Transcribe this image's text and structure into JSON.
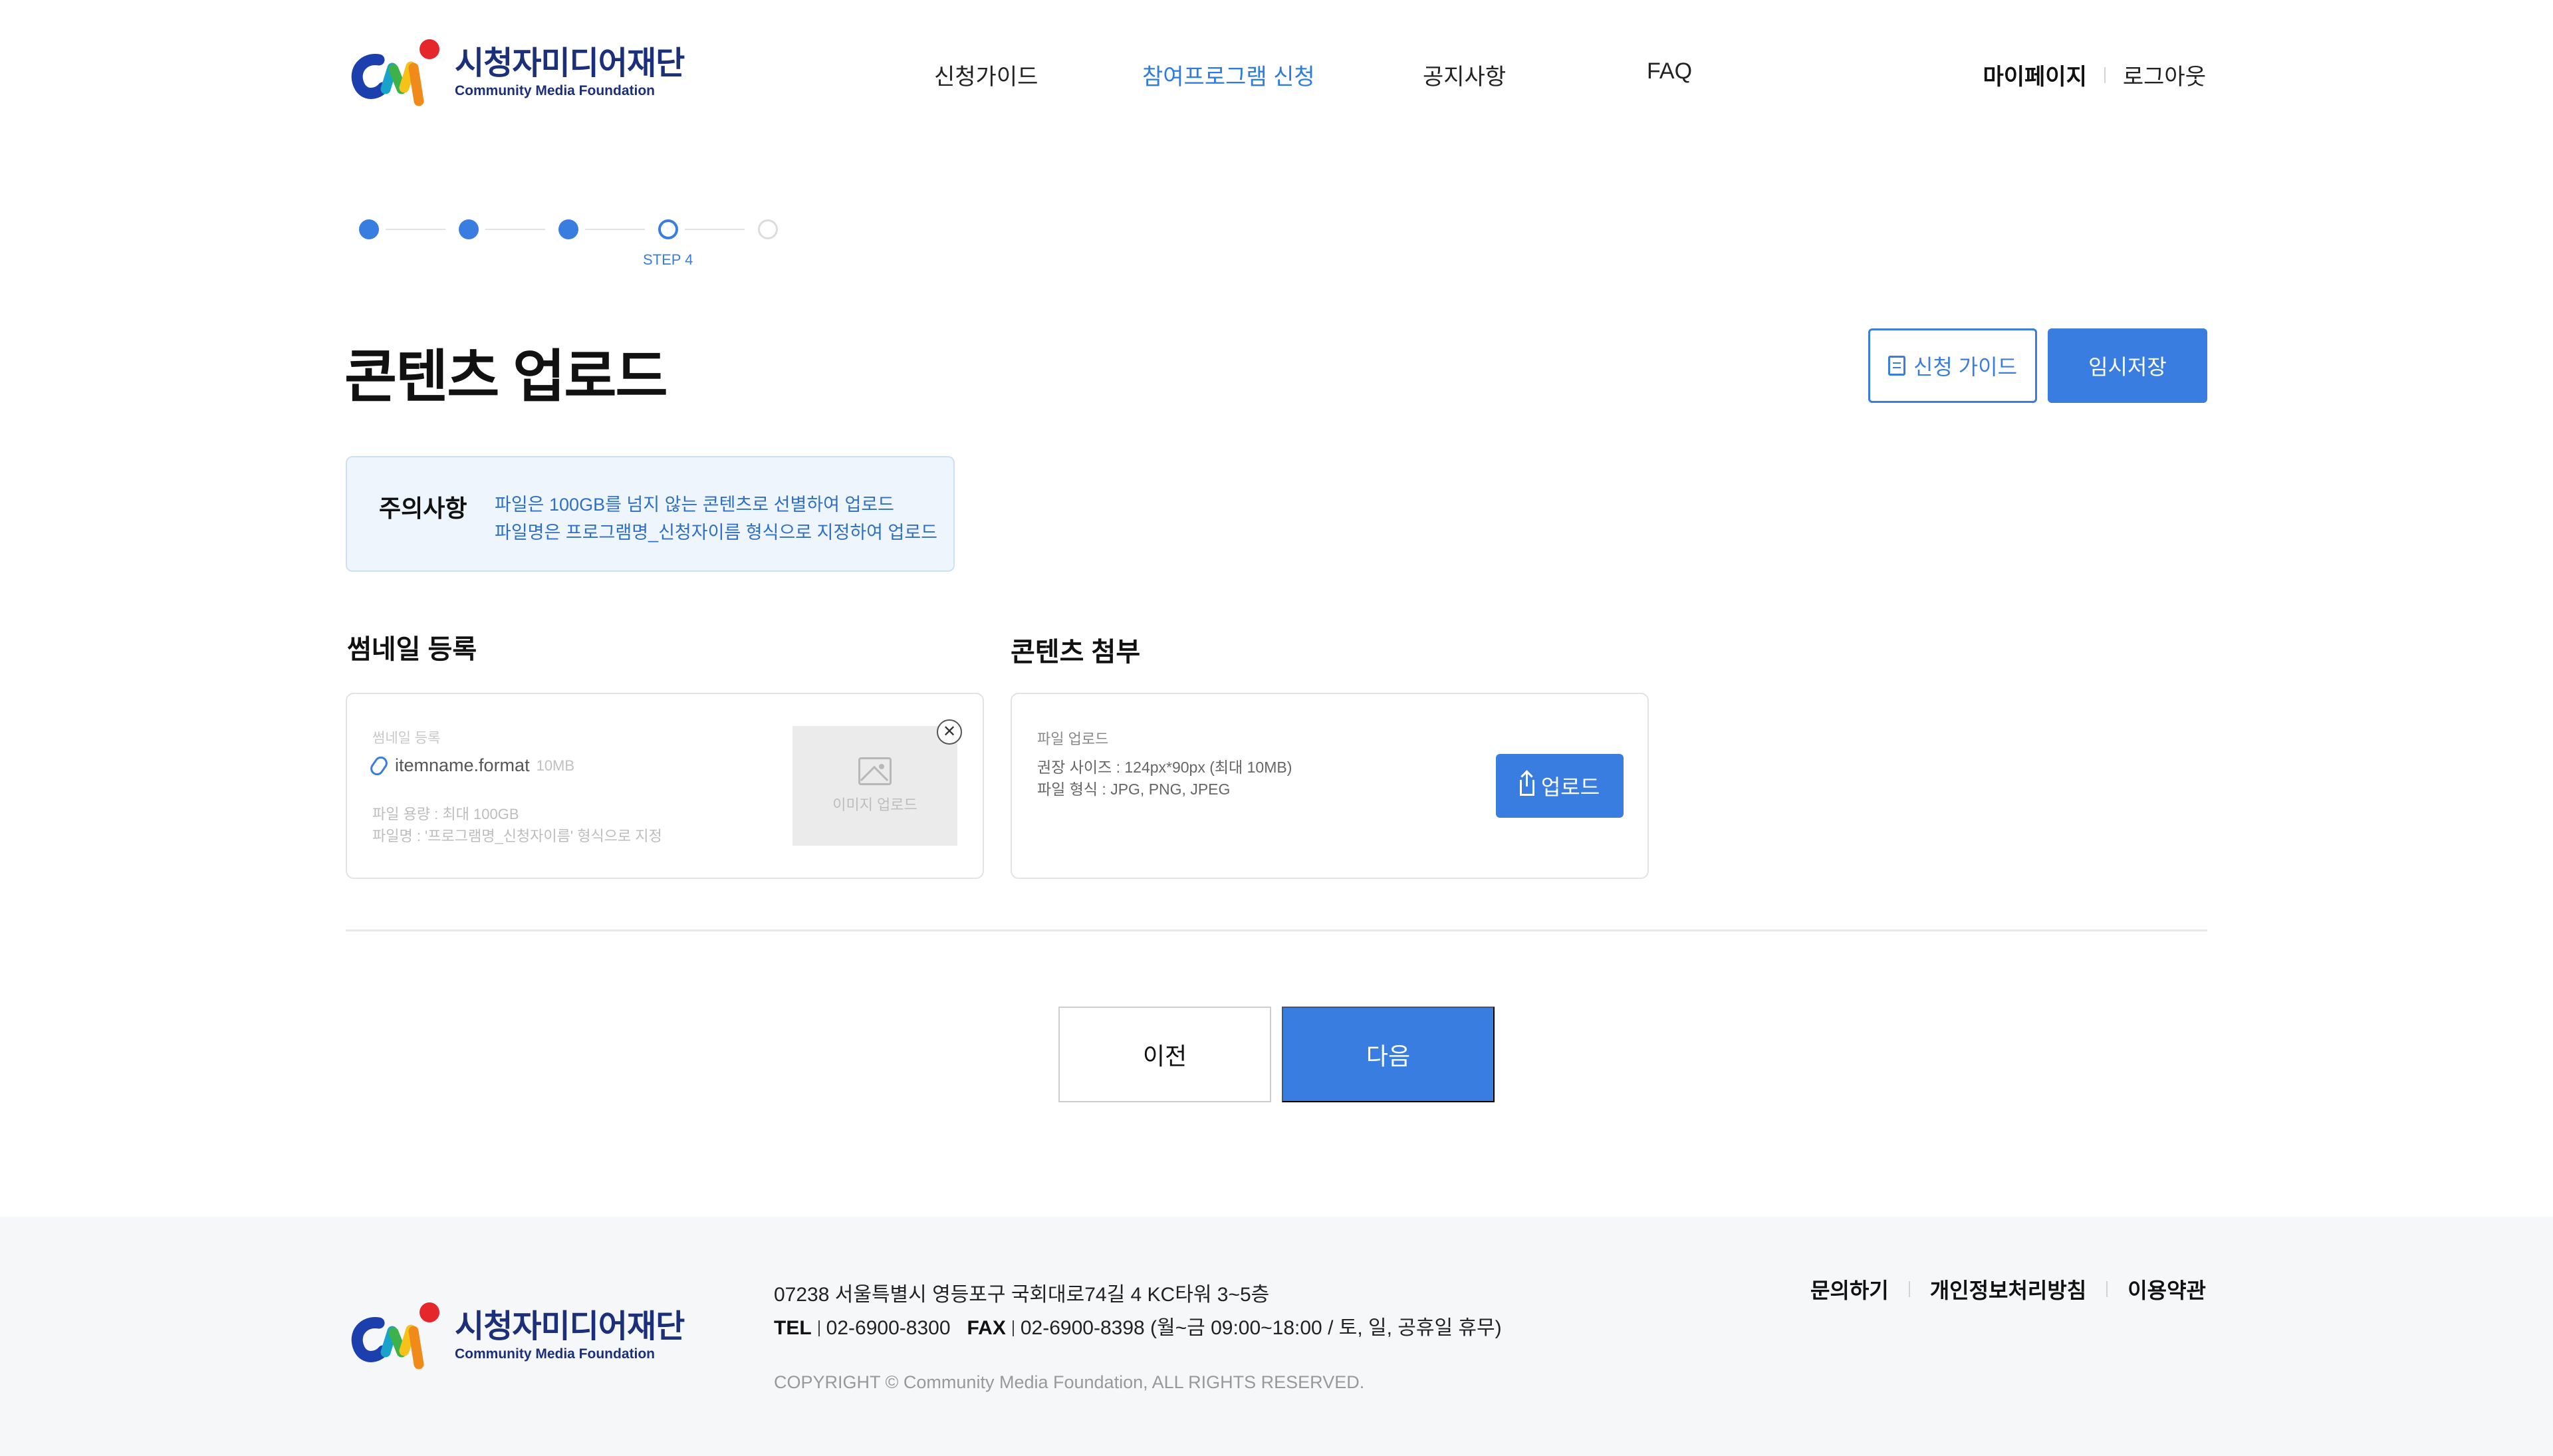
{
  "brand": {
    "name_ko": "시청자미디어재단",
    "name_en": "Community Media Foundation"
  },
  "nav": {
    "items": [
      {
        "label": "신청가이드"
      },
      {
        "label": "참여프로그램 신청"
      },
      {
        "label": "공지사항"
      },
      {
        "label": "FAQ"
      }
    ],
    "active_index": 1,
    "mypage": "마이페이지",
    "logout": "로그아웃"
  },
  "stepper": {
    "total_steps": 5,
    "current_step": 4,
    "current_label": "STEP 4"
  },
  "page": {
    "title": "콘텐츠 업로드",
    "guide_button": "신청 가이드",
    "save_button": "임시저장"
  },
  "notice": {
    "title": "주의사항",
    "lines": [
      "파일은 100GB를 넘지 않는 콘텐츠로 선별하여 업로드",
      "파일명은 프로그램명_신청자이름 형식으로 지정하여 업로드"
    ]
  },
  "thumbnail": {
    "section_title": "썸네일 등록",
    "field_label": "썸네일 등록",
    "filename": "itemname.format",
    "filesize": "10MB",
    "info_lines": [
      "파일 용량 : 최대 100GB",
      "파일명 : '프로그램명_신청자이름' 형식으로 지정"
    ],
    "image_upload_label": "이미지 업로드",
    "remove_symbol": "✕"
  },
  "attachment": {
    "section_title": "콘텐츠 첨부",
    "field_label": "파일 업로드",
    "info_lines": [
      "권장 사이즈 : 124px*90px (최대 10MB)",
      "파일 형식 : JPG, PNG, JPEG"
    ],
    "upload_button": "업로드"
  },
  "actions": {
    "prev": "이전",
    "next": "다음"
  },
  "footer": {
    "address": "07238 서울특별시 영등포구 국회대로74길 4 KC타워 3~5층",
    "tel_label": "TEL",
    "tel": "02-6900-8300",
    "fax_label": "FAX",
    "fax": "02-6900-8398 (월~금 09:00~18:00 / 토, 일, 공휴일 휴무)",
    "copyright": "COPYRIGHT © Community Media Foundation, ALL RIGHTS RESERVED.",
    "links": [
      "문의하기",
      "개인정보처리방침",
      "이용약관"
    ]
  },
  "colors": {
    "accent": "#3a7de0",
    "notice_bg": "#eef5fd",
    "footer_bg": "#f6f7f9",
    "brand_navy": "#1c2f7a"
  }
}
